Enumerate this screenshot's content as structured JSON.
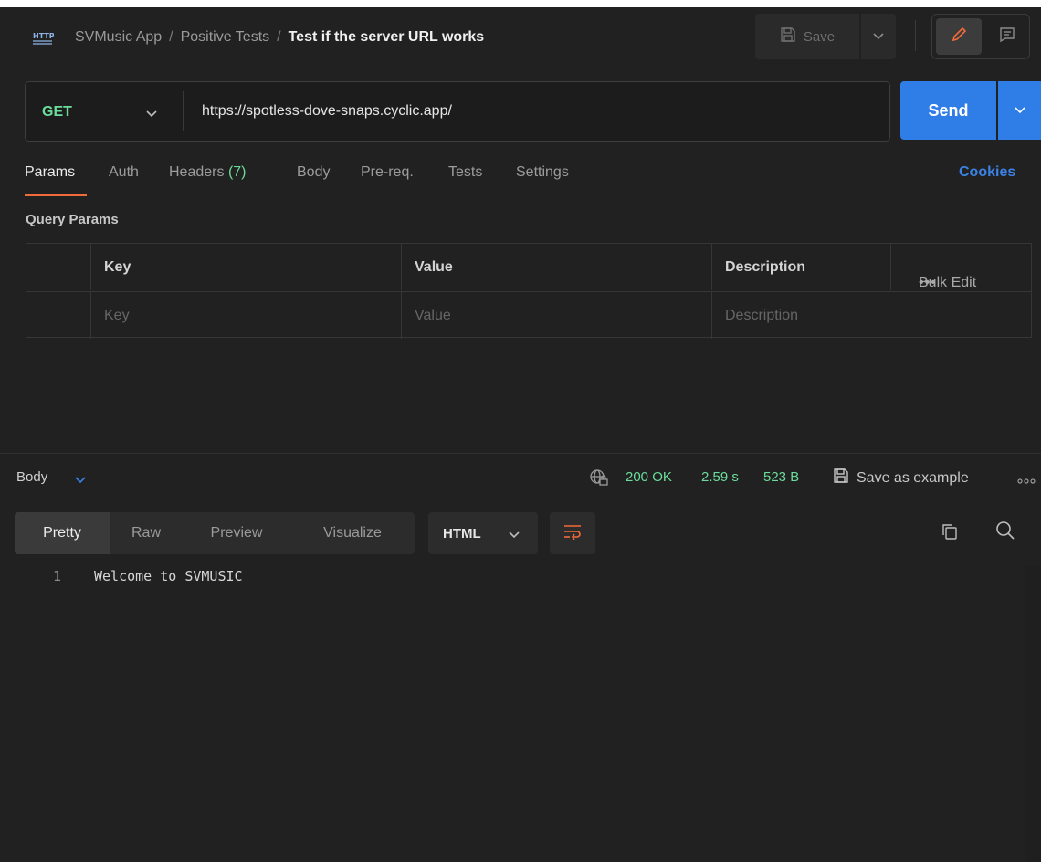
{
  "header": {
    "http_icon": "http-icon",
    "breadcrumb": [
      "SVMusic App",
      "Positive Tests"
    ],
    "separator": "/",
    "request_name": "Test if the server URL works",
    "save_label": "Save",
    "icons": [
      "save-icon",
      "chevron-down-icon",
      "pencil-icon",
      "comment-icon"
    ]
  },
  "request": {
    "method": "GET",
    "url": "https://spotless-dove-snaps.cyclic.app/",
    "send_label": "Send"
  },
  "tabs": [
    {
      "label": "Params",
      "active": true
    },
    {
      "label": "Auth"
    },
    {
      "label": "Headers",
      "count": "(7)"
    },
    {
      "label": "Body"
    },
    {
      "label": "Pre-req."
    },
    {
      "label": "Tests"
    },
    {
      "label": "Settings"
    }
  ],
  "cookies_label": "Cookies",
  "query_params": {
    "title": "Query Params",
    "columns": [
      "Key",
      "Value",
      "Description"
    ],
    "placeholders": [
      "Key",
      "Value",
      "Description"
    ],
    "bulk_dots": "•••",
    "bulk_edit": "Bulk Edit"
  },
  "response": {
    "body_label": "Body",
    "status": "200 OK",
    "time": "2.59 s",
    "size": "523 B",
    "save_example": "Save as example",
    "view_tabs": [
      "Pretty",
      "Raw",
      "Preview",
      "Visualize"
    ],
    "active_view": "Pretty",
    "format": "HTML",
    "lines": [
      {
        "n": "1",
        "text": "Welcome to SVMUSIC"
      }
    ]
  },
  "colors": {
    "background": "#212121",
    "accent_blue": "#2f7de6",
    "method_green": "#6bdd9a",
    "tab_underline": "#f26b3a"
  }
}
